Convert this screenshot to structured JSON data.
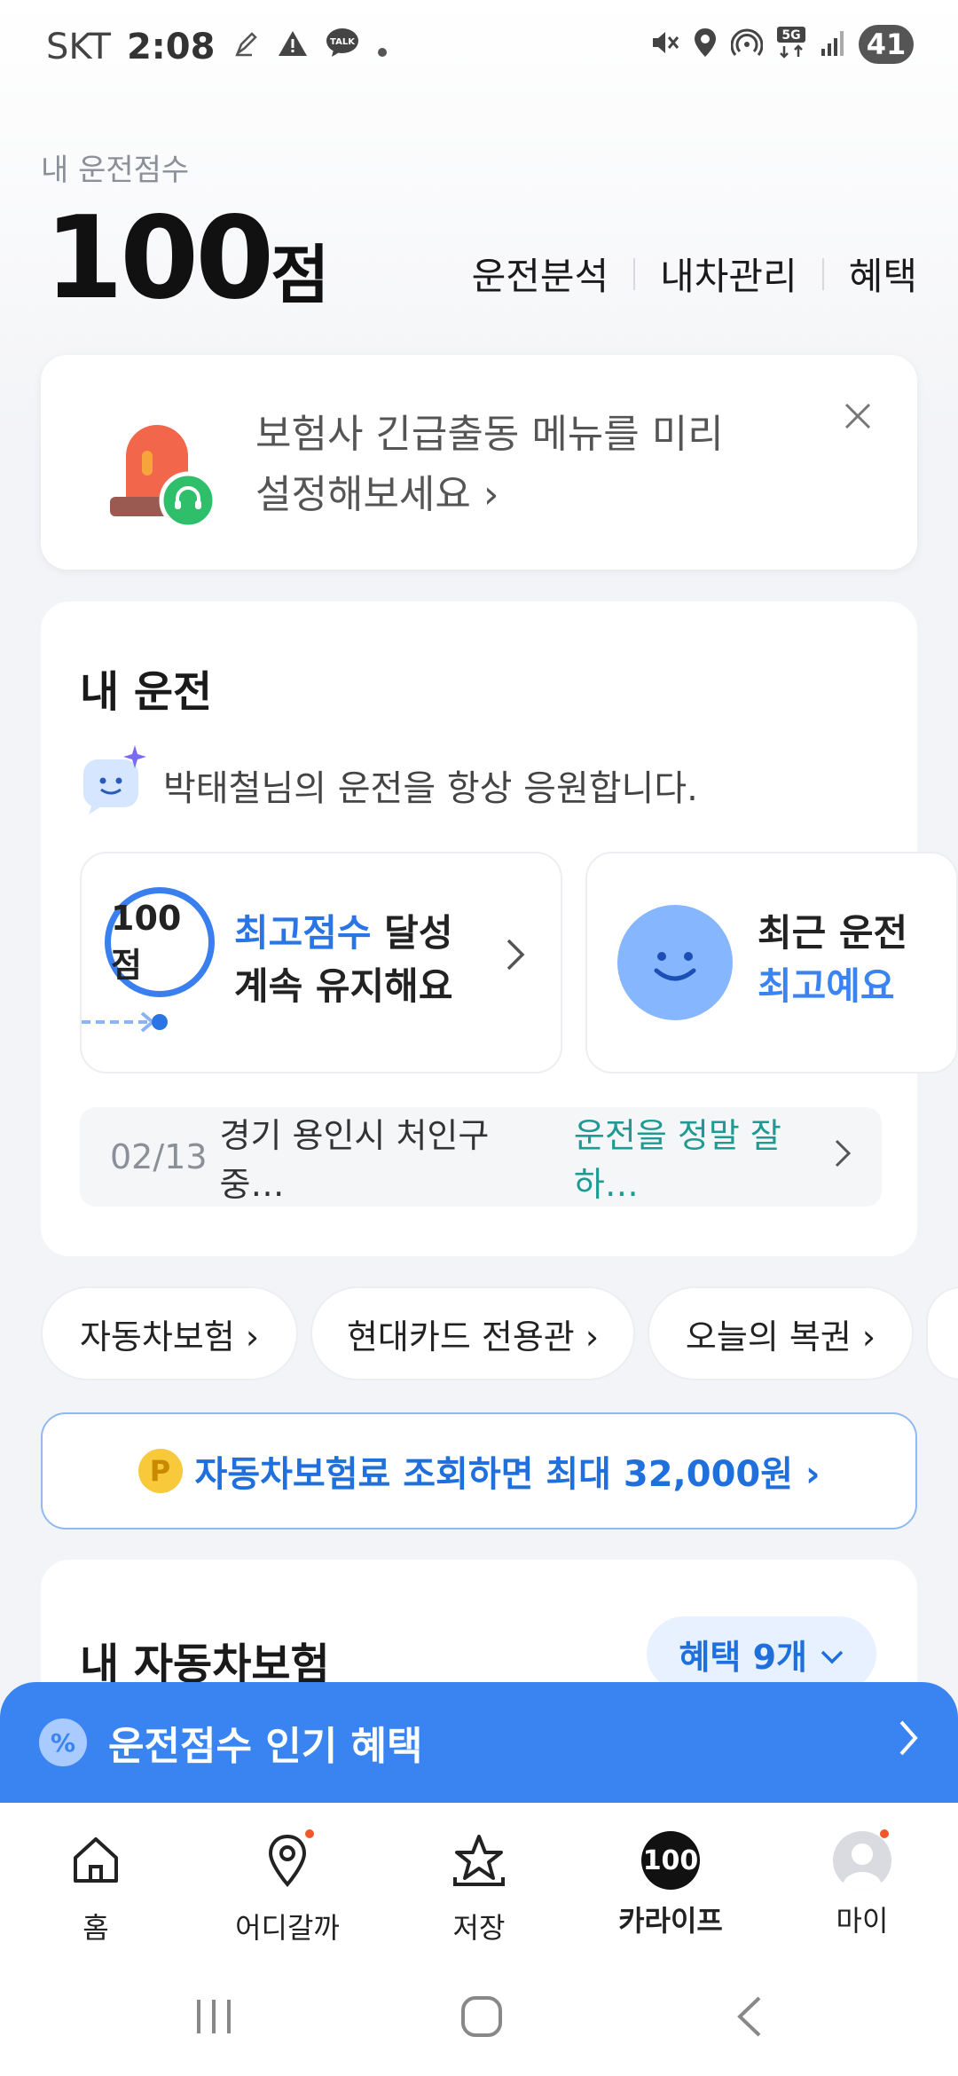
{
  "status_bar": {
    "carrier": "SKT",
    "time": "2:08",
    "network": "5G",
    "battery": "41"
  },
  "header": {
    "score_label": "내 운전점수",
    "score_value": "100",
    "score_unit": "점",
    "nav": [
      "운전분석",
      "내차관리",
      "혜택"
    ]
  },
  "banner": {
    "line1": "보험사 긴급출동 메뉴를 미리",
    "line2": "설정해보세요 ›"
  },
  "my_driving": {
    "title": "내 운전",
    "cheer": "박태철님의 운전을 항상 응원합니다.",
    "card1": {
      "ring": "100점",
      "highlight": "최고점수",
      "line1_rest": " 달성",
      "line2": "계속 유지해요"
    },
    "card2": {
      "line1": "최근 운전 ",
      "line2": "최고예요"
    },
    "recent": {
      "date": "02/13",
      "location": "경기 용인시 처인구 중…",
      "comment": "운전을 정말 잘하…"
    }
  },
  "chips": [
    "자동차보험 ›",
    "현대카드 전용관 ›",
    "오늘의 복권 ›"
  ],
  "promo": {
    "coin": "P",
    "text": "자동차보험료 조회하면 최대 32,000원 ›"
  },
  "insurance": {
    "title": "내 자동차보험",
    "pill": "혜택 9개"
  },
  "popular_bar": {
    "icon": "%",
    "text": "운전점수 인기 혜택"
  },
  "bottom_nav": {
    "items": [
      "홈",
      "어디갈까",
      "저장",
      "카라이프",
      "마이"
    ],
    "badge": "100",
    "active": "카라이프"
  }
}
